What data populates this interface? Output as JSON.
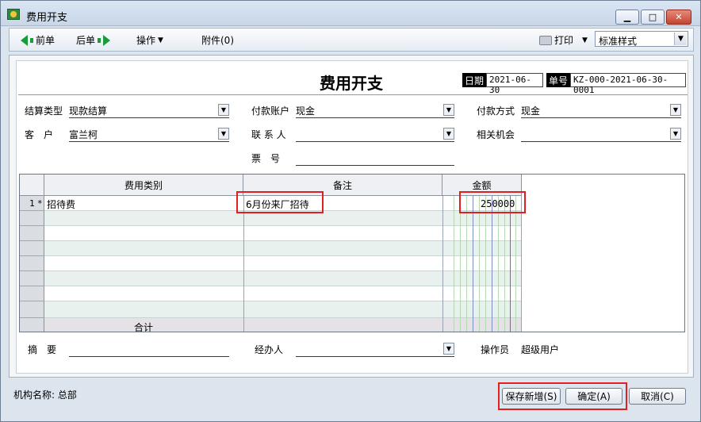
{
  "window": {
    "title": "费用开支"
  },
  "toolbar": {
    "prev_label": "前单",
    "next_label": "后单",
    "ops_label": "操作",
    "attach_label": "附件(0)",
    "print_label": "打印",
    "style_select": "标准样式"
  },
  "header": {
    "doc_title": "费用开支",
    "date_tag": "日期",
    "date_value": "2021-06-30",
    "no_tag": "单号",
    "no_value": "KZ-000-2021-06-30-0001"
  },
  "fields": {
    "settle_type_label": "结算类型",
    "settle_type_value": "现款结算",
    "pay_account_label": "付款账户",
    "pay_account_value": "现金",
    "pay_method_label": "付款方式",
    "pay_method_value": "现金",
    "customer_label": "客　户",
    "customer_value": "富兰柯",
    "contact_label": "联 系 人",
    "contact_value": "",
    "opportunity_label": "相关机会",
    "opportunity_value": "",
    "ticket_label": "票　号",
    "ticket_value": ""
  },
  "grid": {
    "headers": {
      "category": "费用类别",
      "remark": "备注",
      "amount": "金额"
    },
    "rows": [
      {
        "index": "1 *",
        "category": "招待费",
        "remark": "6月份来厂招待",
        "amount_digits": "250000"
      }
    ],
    "total_label": "合计"
  },
  "footer": {
    "summary_label": "摘　要",
    "summary_value": "",
    "handler_label": "经办人",
    "handler_value": "",
    "operator_label": "操作员",
    "operator_value": "超级用户"
  },
  "bottom": {
    "org_label": "机构名称: 总部",
    "save_new_label": "保存新增(S)",
    "ok_label": "确定(A)",
    "cancel_label": "取消(C)"
  },
  "colors": {
    "highlight": "#e02020",
    "arrow": "#1b9a3a"
  }
}
